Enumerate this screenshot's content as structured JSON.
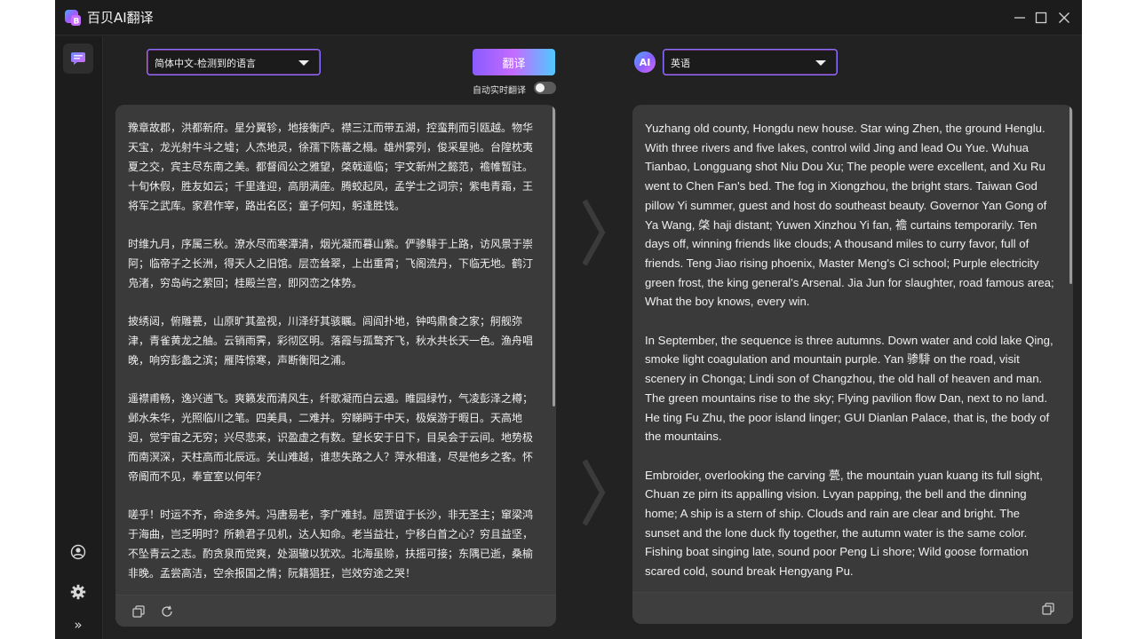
{
  "window": {
    "title": "百贝AI翻译",
    "accent": "#8a5cff",
    "icons": [
      "app-logo-icon",
      "minimize-icon",
      "maximize-icon",
      "close-icon"
    ]
  },
  "sidebar": {
    "items": [
      {
        "name": "translate-nav",
        "icon": "chat-icon",
        "active": true
      },
      {
        "name": "account",
        "icon": "user-circle-icon"
      },
      {
        "name": "settings",
        "icon": "gear-icon"
      },
      {
        "name": "expand",
        "icon": "chevron-double-right-icon",
        "label": "»"
      }
    ]
  },
  "toolbar": {
    "source_language": "简体中文-检测到的语言",
    "target_language": "英语",
    "translate_label": "翻译",
    "realtime_label": "自动实时翻译",
    "realtime_enabled": false,
    "ai_badge_label": "AI"
  },
  "source": {
    "paragraphs": [
      "豫章故郡，洪都新府。星分翼轸，地接衡庐。襟三江而带五湖，控蛮荆而引瓯越。物华天宝，龙光射牛斗之墟；人杰地灵，徐孺下陈蕃之榻。雄州雾列，俊采星驰。台隍枕夷夏之交，宾主尽东南之美。都督阎公之雅望，棨戟遥临；宇文新州之懿范，襜帷暂驻。十旬休假，胜友如云；千里逢迎，高朋满座。腾蛟起凤，孟学士之词宗；紫电青霜，王将军之武库。家君作宰，路出名区；童子何知，躬逢胜饯。",
      "时维九月，序属三秋。潦水尽而寒潭清，烟光凝而暮山紫。俨骖騑于上路，访风景于崇阿；临帝子之长洲，得天人之旧馆。层峦耸翠，上出重霄；飞阁流丹，下临无地。鹤汀凫渚，穷岛屿之萦回；桂殿兰宫，即冈峦之体势。",
      "披绣闼，俯雕甍，山原旷其盈视，川泽纡其骇瞩。闾阎扑地，钟鸣鼎食之家；舸舰弥津，青雀黄龙之舳。云销雨霁，彩彻区明。落霞与孤鹜齐飞，秋水共长天一色。渔舟唱晚，响穷彭蠡之滨；雁阵惊寒，声断衡阳之浦。",
      "遥襟甫畅，逸兴遄飞。爽籁发而清风生，纤歌凝而白云遏。睢园绿竹，气凌彭泽之樽；邺水朱华，光照临川之笔。四美具，二难并。穷睇眄于中天，极娱游于暇日。天高地迥，觉宇宙之无穷；兴尽悲来，识盈虚之有数。望长安于日下，目吴会于云间。地势极而南溟深，天柱高而北辰远。关山难越，谁悲失路之人？萍水相逢，尽是他乡之客。怀帝阍而不见，奉宣室以何年？",
      "嗟乎！时运不齐，命途多舛。冯唐易老，李广难封。屈贾谊于长沙，非无圣主；窜梁鸿于海曲，岂乏明时？所赖君子见机，达人知命。老当益壮，宁移白首之心？穷且益坚，不坠青云之志。酌贪泉而觉爽，处涸辙以犹欢。北海虽赊，扶摇可接；东隅已逝，桑榆非晚。孟尝高洁，空余报国之情；阮籍猖狂，岂效穷途之哭！"
    ],
    "footer_icons": [
      "copy-icon",
      "refresh-icon"
    ]
  },
  "target": {
    "paragraphs": [
      "Yuzhang old county, Hongdu new house. Star wing Zhen, the ground Henglu. With three rivers and five lakes, control wild Jing and lead Ou Yue. Wuhua Tianbao, Longguang shot Niu Dou Xu; The people were excellent, and Xu Ru went to Chen Fan's bed. The fog in Xiongzhou, the bright stars. Taiwan God pillow Yi summer, guest and host do southeast beauty. Governor Yan Gong of Ya Wang, 棨 haji distant; Yuwen Xinzhou Yi fan, 襜 curtains temporarily. Ten days off, winning friends like clouds; A thousand miles to curry favor, full of friends. Teng Jiao rising phoenix, Master Meng's Ci school; Purple electricity green frost, the king general's Arsenal. Jia Jun for slaughter, road famous area; What the boy knows, every win.",
      "In September, the sequence is three autumns. Down water and cold lake Qing, smoke light coagulation and mountain purple. Yan 骖騑 on the road, visit scenery in Chonga; Lindi son of Changzhou, the old hall of heaven and man. The green mountains rise to the sky; Flying pavilion flow Dan, next to no land. He ting Fu Zhu, the poor island linger; GUI Dianlan Palace, that is, the body of the mountains.",
      "Embroider, overlooking the carving 甍, the mountain yuan kuang its full sight, Chuan ze pirn its appalling vision. Lvyan papping, the bell and the dinning home; A ship is a stern of ship. Clouds and rain are clear and bright. The sunset and the lone duck fly together, the autumn water is the same color. Fishing boat singing late, sound poor Peng Li shore; Wild goose formation scared cold, sound break Hengyang Pu."
    ],
    "footer_icons": [
      "copy-icon"
    ]
  },
  "center_arrows": [
    "chevron-right-icon",
    "chevron-right-icon"
  ]
}
